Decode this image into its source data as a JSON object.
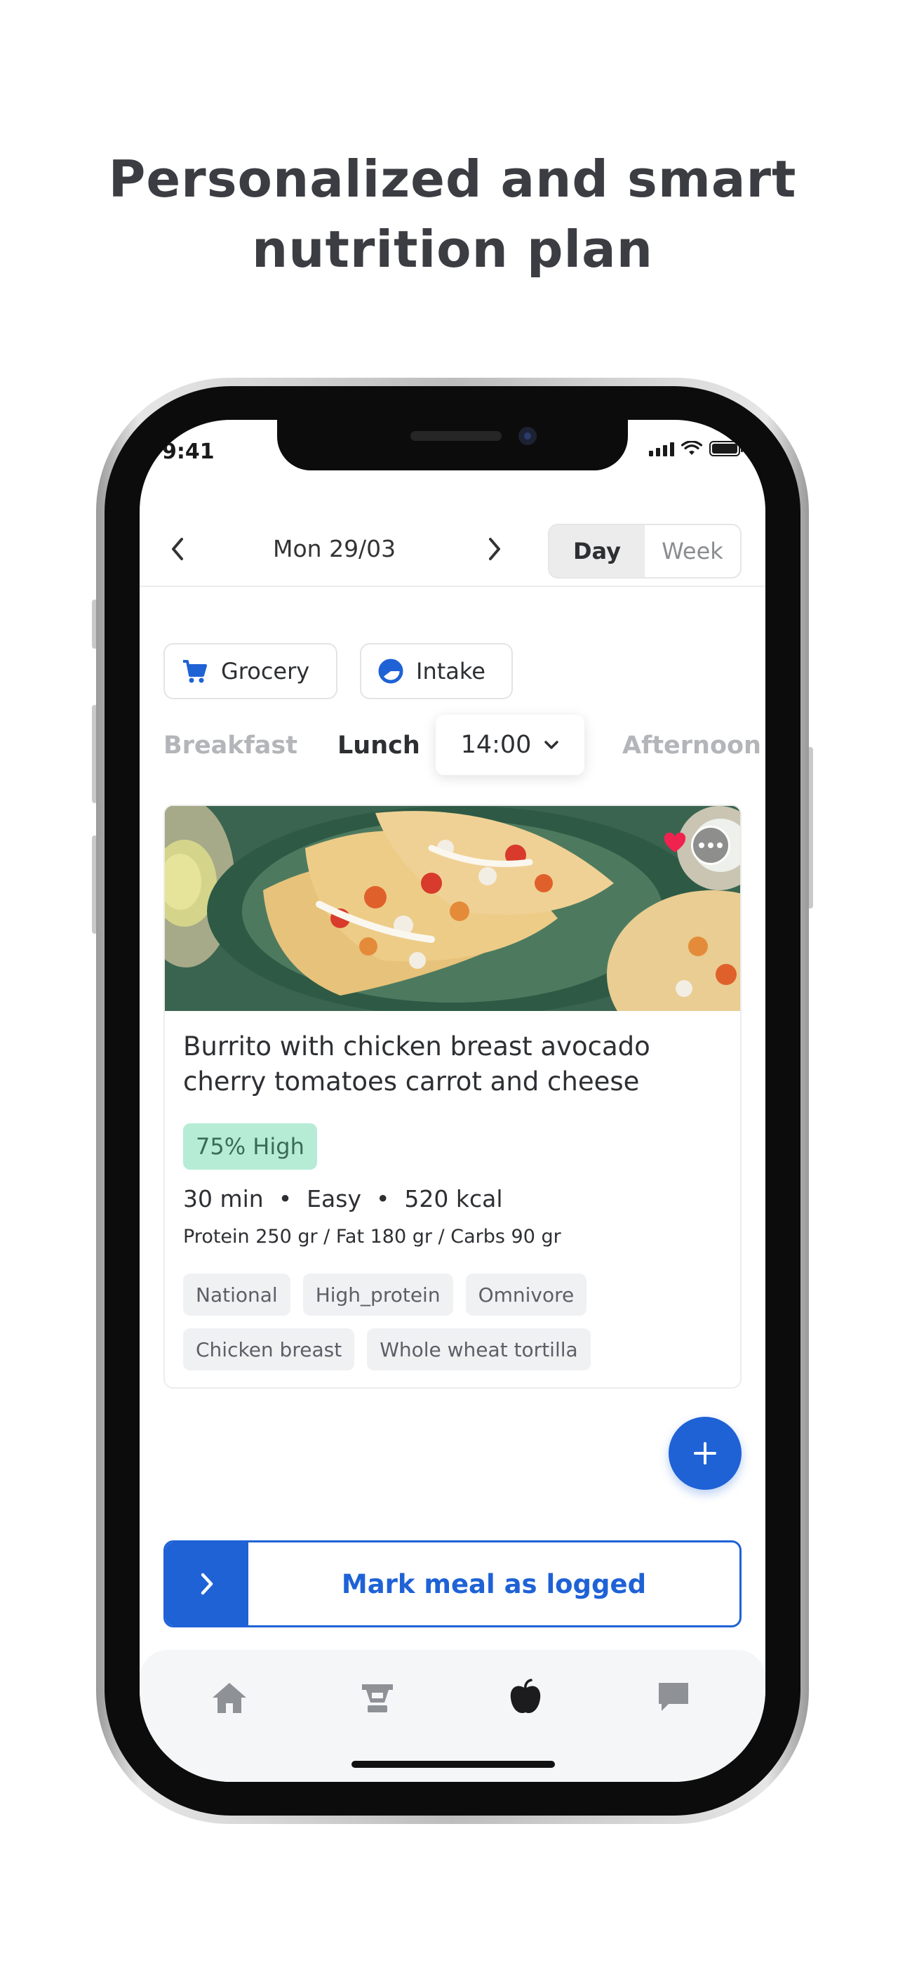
{
  "headline": {
    "line1": "Personalized and smart",
    "line2": "nutrition plan"
  },
  "status_bar": {
    "time": "9:41"
  },
  "date_nav": {
    "date": "Mon 29/03",
    "view_options": [
      "Day",
      "Week"
    ],
    "selected_view": "Day"
  },
  "chips": {
    "grocery": "Grocery",
    "intake": "Intake"
  },
  "meal_tabs": {
    "items": [
      "Breakfast",
      "Lunch",
      "Afternoon"
    ],
    "active": "Lunch",
    "time": "14:00"
  },
  "meal_card": {
    "title": "Burrito with chicken breast avocado cherry tomatoes carrot and cheese",
    "score": "75% High",
    "duration": "30 min",
    "difficulty": "Easy",
    "calories": "520 kcal",
    "macros": "Protein 250 gr / Fat 180 gr / Carbs 90 gr",
    "tags": [
      "National",
      "High_protein",
      "Omnivore",
      "Chicken breast",
      "Whole wheat tortilla"
    ],
    "favorited": true
  },
  "actions": {
    "add": "+",
    "log_meal": "Mark meal as logged"
  },
  "tab_bar": {
    "items": [
      "home-icon",
      "workout-icon",
      "nutrition-icon",
      "chat-icon"
    ],
    "active": "nutrition-icon"
  },
  "colors": {
    "accent": "#1f62d6",
    "score_bg": "#b6ecd6",
    "heart": "#f0234f"
  }
}
